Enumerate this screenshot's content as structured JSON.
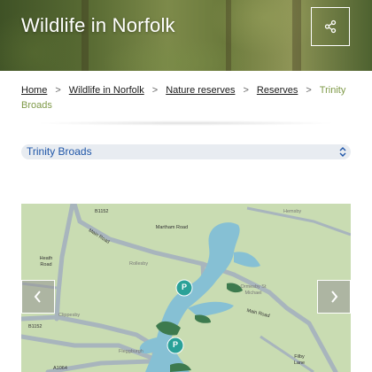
{
  "header": {
    "title": "Wildlife in Norfolk",
    "share_icon": "share-icon"
  },
  "breadcrumb": {
    "items": [
      "Home",
      "Wildlife in Norfolk",
      "Nature reserves",
      "Reserves"
    ],
    "current": "Trinity Broads",
    "separator": ">"
  },
  "reserve_selector": {
    "selected": "Trinity Broads",
    "icon": "chevron-updown-icon"
  },
  "map": {
    "labels": {
      "b1152_top": "B1152",
      "hemsby": "Hemsby",
      "main_road_top": "Main Road",
      "martham_road": "Martham Road",
      "heath_road": "Heath Road",
      "rollesby": "Rollesby",
      "ormesby": "Ormesby St Michael",
      "main_road_right": "Main Road",
      "clippesby": "Clippesby",
      "b1152_left": "B1152",
      "fleggburgh": "Fleggburgh",
      "filby_lane": "Filby Lane",
      "a1064": "A1064",
      "parking": "P"
    },
    "colors": {
      "land": "#c9dcb2",
      "water": "#86c0d4",
      "woodland": "#3d7a4e",
      "road": "#a8b5bd",
      "parking": "#2aa198"
    }
  },
  "carousel": {
    "prev_icon": "chevron-left-icon",
    "next_icon": "chevron-right-icon"
  }
}
